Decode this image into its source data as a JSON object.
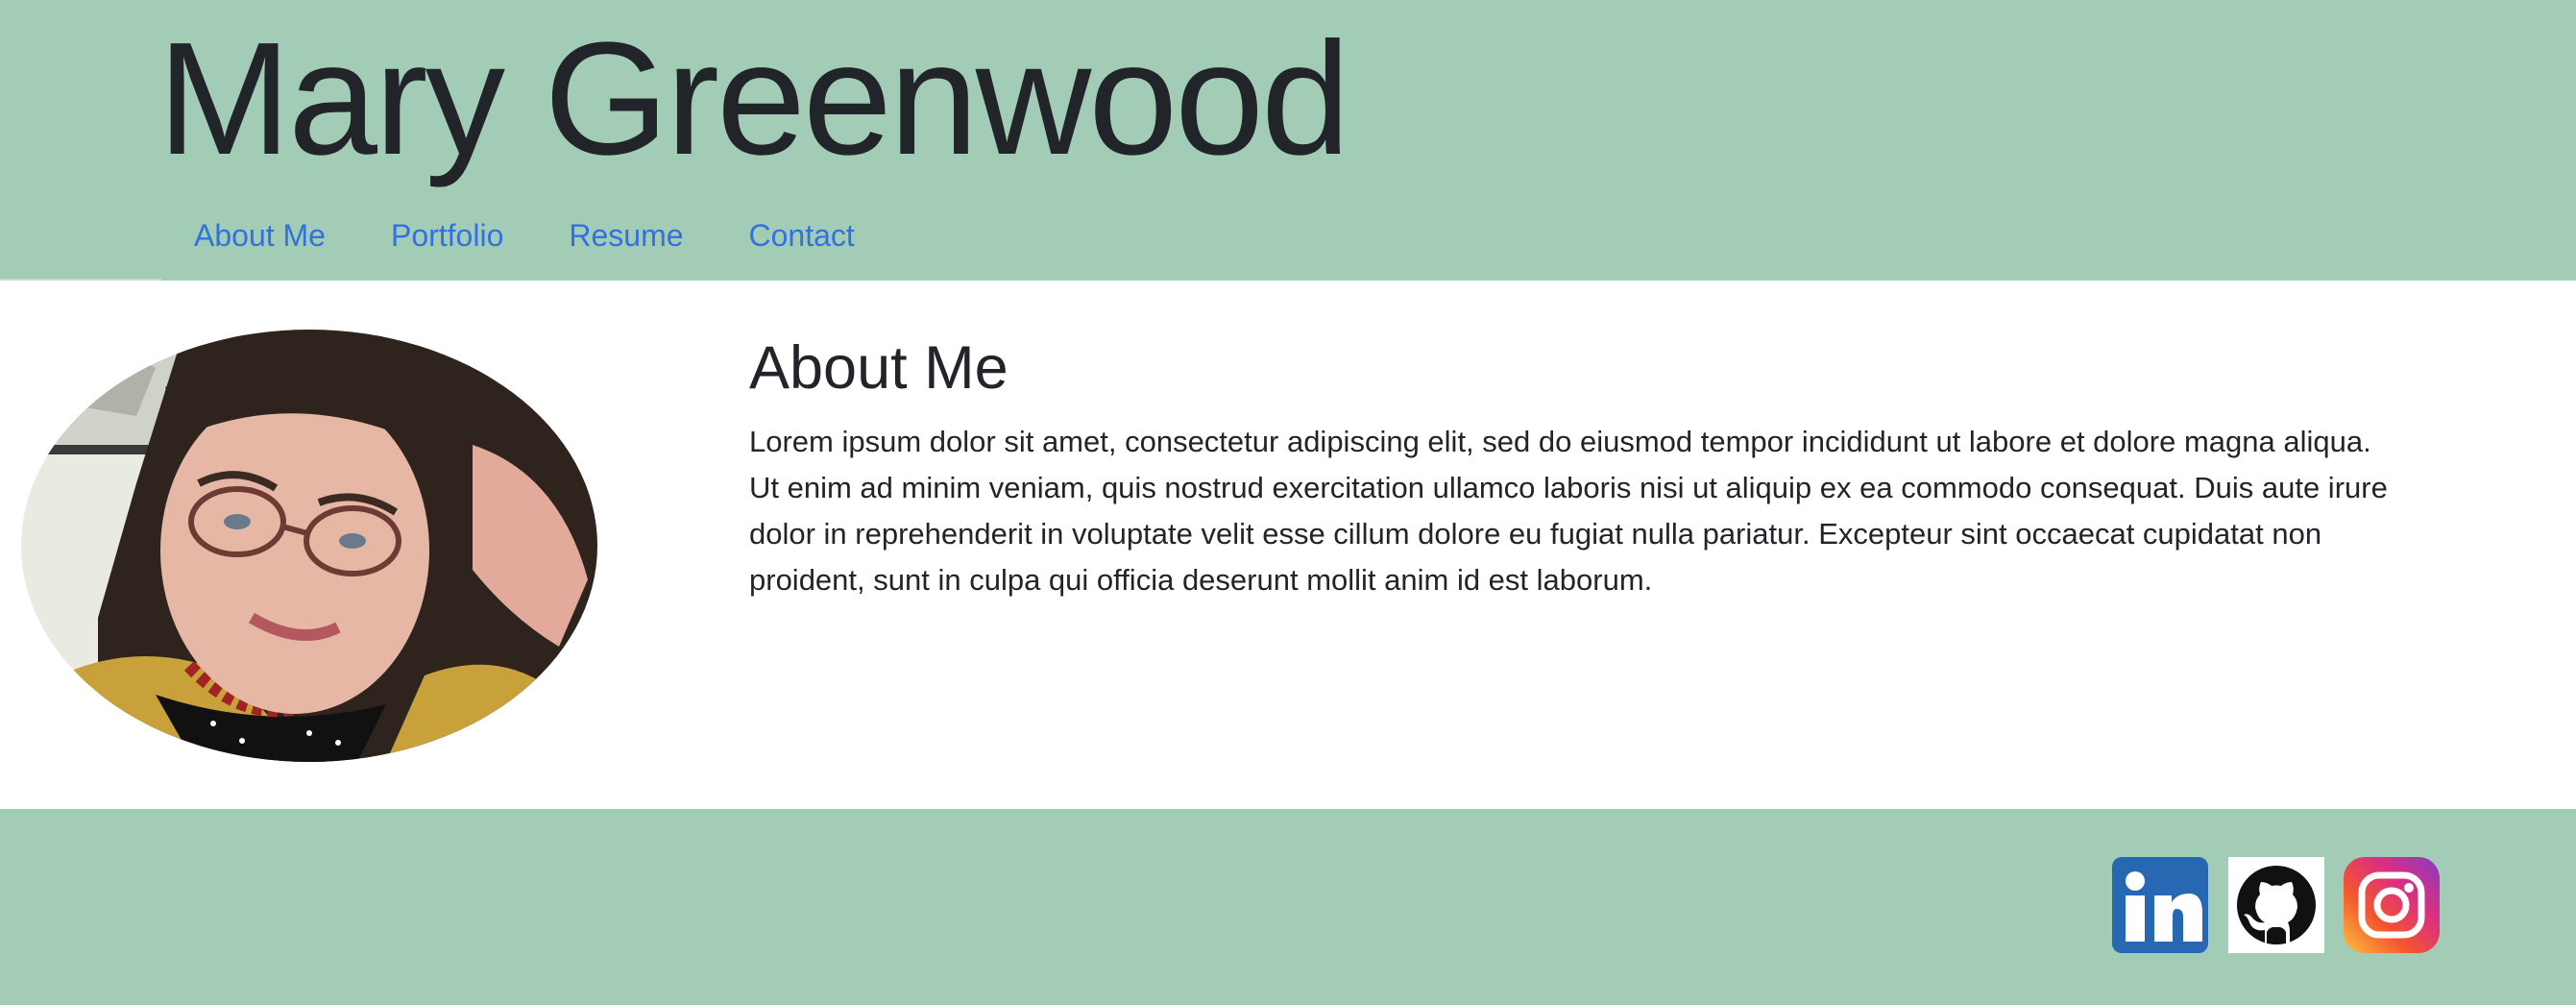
{
  "header": {
    "title": "Mary Greenwood"
  },
  "nav": {
    "items": [
      {
        "label": "About Me"
      },
      {
        "label": "Portfolio"
      },
      {
        "label": "Resume"
      },
      {
        "label": "Contact"
      }
    ]
  },
  "about": {
    "heading": "About Me",
    "body": "Lorem ipsum dolor sit amet, consectetur adipiscing elit, sed do eiusmod tempor incididunt ut labore et dolore magna aliqua. Ut enim ad minim veniam, quis nostrud exercitation ullamco laboris nisi ut aliquip ex ea commodo consequat. Duis aute irure dolor in reprehenderit in voluptate velit esse cillum dolore eu fugiat nulla pariatur. Excepteur sint occaecat cupidatat non proident, sunt in culpa qui officia deserunt mollit anim id est laborum."
  },
  "footer": {
    "social": [
      {
        "icon": "linkedin-icon"
      },
      {
        "icon": "github-icon"
      },
      {
        "icon": "instagram-icon"
      }
    ]
  },
  "colors": {
    "header_bg": "#a2ccb6",
    "footer_bg": "#a2ccb6",
    "nav_link": "#3272e0",
    "text": "#212529",
    "linkedin": "#2867b2"
  }
}
